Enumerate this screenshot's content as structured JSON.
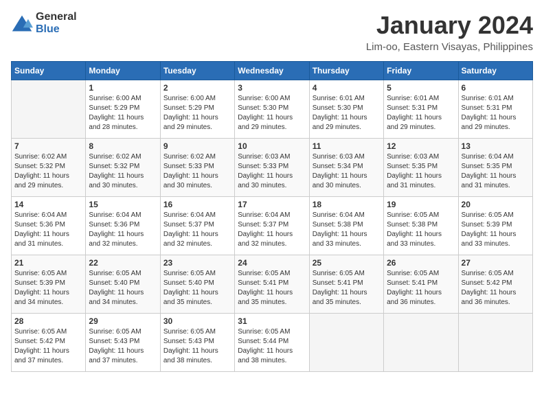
{
  "header": {
    "logo": {
      "general": "General",
      "blue": "Blue"
    },
    "title": "January 2024",
    "location": "Lim-oo, Eastern Visayas, Philippines"
  },
  "calendar": {
    "headers": [
      "Sunday",
      "Monday",
      "Tuesday",
      "Wednesday",
      "Thursday",
      "Friday",
      "Saturday"
    ],
    "weeks": [
      [
        {
          "day": "",
          "info": ""
        },
        {
          "day": "1",
          "info": "Sunrise: 6:00 AM\nSunset: 5:29 PM\nDaylight: 11 hours\nand 28 minutes."
        },
        {
          "day": "2",
          "info": "Sunrise: 6:00 AM\nSunset: 5:29 PM\nDaylight: 11 hours\nand 29 minutes."
        },
        {
          "day": "3",
          "info": "Sunrise: 6:00 AM\nSunset: 5:30 PM\nDaylight: 11 hours\nand 29 minutes."
        },
        {
          "day": "4",
          "info": "Sunrise: 6:01 AM\nSunset: 5:30 PM\nDaylight: 11 hours\nand 29 minutes."
        },
        {
          "day": "5",
          "info": "Sunrise: 6:01 AM\nSunset: 5:31 PM\nDaylight: 11 hours\nand 29 minutes."
        },
        {
          "day": "6",
          "info": "Sunrise: 6:01 AM\nSunset: 5:31 PM\nDaylight: 11 hours\nand 29 minutes."
        }
      ],
      [
        {
          "day": "7",
          "info": "Sunrise: 6:02 AM\nSunset: 5:32 PM\nDaylight: 11 hours\nand 29 minutes."
        },
        {
          "day": "8",
          "info": "Sunrise: 6:02 AM\nSunset: 5:32 PM\nDaylight: 11 hours\nand 30 minutes."
        },
        {
          "day": "9",
          "info": "Sunrise: 6:02 AM\nSunset: 5:33 PM\nDaylight: 11 hours\nand 30 minutes."
        },
        {
          "day": "10",
          "info": "Sunrise: 6:03 AM\nSunset: 5:33 PM\nDaylight: 11 hours\nand 30 minutes."
        },
        {
          "day": "11",
          "info": "Sunrise: 6:03 AM\nSunset: 5:34 PM\nDaylight: 11 hours\nand 30 minutes."
        },
        {
          "day": "12",
          "info": "Sunrise: 6:03 AM\nSunset: 5:35 PM\nDaylight: 11 hours\nand 31 minutes."
        },
        {
          "day": "13",
          "info": "Sunrise: 6:04 AM\nSunset: 5:35 PM\nDaylight: 11 hours\nand 31 minutes."
        }
      ],
      [
        {
          "day": "14",
          "info": "Sunrise: 6:04 AM\nSunset: 5:36 PM\nDaylight: 11 hours\nand 31 minutes."
        },
        {
          "day": "15",
          "info": "Sunrise: 6:04 AM\nSunset: 5:36 PM\nDaylight: 11 hours\nand 32 minutes."
        },
        {
          "day": "16",
          "info": "Sunrise: 6:04 AM\nSunset: 5:37 PM\nDaylight: 11 hours\nand 32 minutes."
        },
        {
          "day": "17",
          "info": "Sunrise: 6:04 AM\nSunset: 5:37 PM\nDaylight: 11 hours\nand 32 minutes."
        },
        {
          "day": "18",
          "info": "Sunrise: 6:04 AM\nSunset: 5:38 PM\nDaylight: 11 hours\nand 33 minutes."
        },
        {
          "day": "19",
          "info": "Sunrise: 6:05 AM\nSunset: 5:38 PM\nDaylight: 11 hours\nand 33 minutes."
        },
        {
          "day": "20",
          "info": "Sunrise: 6:05 AM\nSunset: 5:39 PM\nDaylight: 11 hours\nand 33 minutes."
        }
      ],
      [
        {
          "day": "21",
          "info": "Sunrise: 6:05 AM\nSunset: 5:39 PM\nDaylight: 11 hours\nand 34 minutes."
        },
        {
          "day": "22",
          "info": "Sunrise: 6:05 AM\nSunset: 5:40 PM\nDaylight: 11 hours\nand 34 minutes."
        },
        {
          "day": "23",
          "info": "Sunrise: 6:05 AM\nSunset: 5:40 PM\nDaylight: 11 hours\nand 35 minutes."
        },
        {
          "day": "24",
          "info": "Sunrise: 6:05 AM\nSunset: 5:41 PM\nDaylight: 11 hours\nand 35 minutes."
        },
        {
          "day": "25",
          "info": "Sunrise: 6:05 AM\nSunset: 5:41 PM\nDaylight: 11 hours\nand 35 minutes."
        },
        {
          "day": "26",
          "info": "Sunrise: 6:05 AM\nSunset: 5:41 PM\nDaylight: 11 hours\nand 36 minutes."
        },
        {
          "day": "27",
          "info": "Sunrise: 6:05 AM\nSunset: 5:42 PM\nDaylight: 11 hours\nand 36 minutes."
        }
      ],
      [
        {
          "day": "28",
          "info": "Sunrise: 6:05 AM\nSunset: 5:42 PM\nDaylight: 11 hours\nand 37 minutes."
        },
        {
          "day": "29",
          "info": "Sunrise: 6:05 AM\nSunset: 5:43 PM\nDaylight: 11 hours\nand 37 minutes."
        },
        {
          "day": "30",
          "info": "Sunrise: 6:05 AM\nSunset: 5:43 PM\nDaylight: 11 hours\nand 38 minutes."
        },
        {
          "day": "31",
          "info": "Sunrise: 6:05 AM\nSunset: 5:44 PM\nDaylight: 11 hours\nand 38 minutes."
        },
        {
          "day": "",
          "info": ""
        },
        {
          "day": "",
          "info": ""
        },
        {
          "day": "",
          "info": ""
        }
      ]
    ]
  }
}
